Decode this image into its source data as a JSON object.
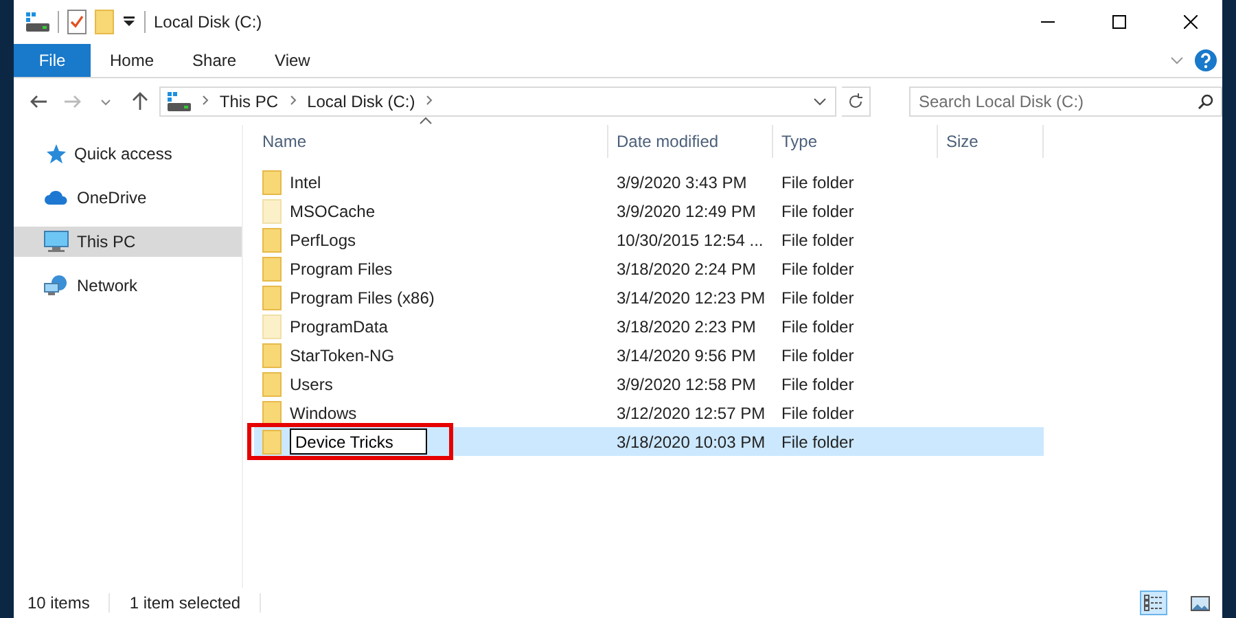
{
  "window": {
    "title": "Local Disk (C:)"
  },
  "ribbon_tabs": [
    {
      "label": "File",
      "kind": "file",
      "selected": false
    },
    {
      "label": "Home",
      "kind": "tab",
      "selected": false
    },
    {
      "label": "Share",
      "kind": "tab",
      "selected": false
    },
    {
      "label": "View",
      "kind": "tab",
      "selected": false
    }
  ],
  "address_bar": {
    "breadcrumbs": [
      "This PC",
      "Local Disk (C:)"
    ]
  },
  "search": {
    "placeholder": "Search Local Disk (C:)"
  },
  "sidebar": {
    "items": [
      {
        "label": "Quick access",
        "kind": "quick",
        "selected": false
      },
      {
        "label": "OneDrive",
        "kind": "cloud",
        "selected": false
      },
      {
        "label": "This PC",
        "kind": "pc",
        "selected": true
      },
      {
        "label": "Network",
        "kind": "network",
        "selected": false
      }
    ]
  },
  "table": {
    "columns": [
      "Name",
      "Date modified",
      "Type",
      "Size"
    ],
    "rows": [
      {
        "name": "Intel",
        "date": "3/9/2020 3:43 PM",
        "type": "File folder",
        "hidden": false,
        "selected": false,
        "editing": false,
        "highlighted": false
      },
      {
        "name": "MSOCache",
        "date": "3/9/2020 12:49 PM",
        "type": "File folder",
        "hidden": true,
        "selected": false,
        "editing": false,
        "highlighted": false
      },
      {
        "name": "PerfLogs",
        "date": "10/30/2015 12:54 ...",
        "type": "File folder",
        "hidden": false,
        "selected": false,
        "editing": false,
        "highlighted": false
      },
      {
        "name": "Program Files",
        "date": "3/18/2020 2:24 PM",
        "type": "File folder",
        "hidden": false,
        "selected": false,
        "editing": false,
        "highlighted": false
      },
      {
        "name": "Program Files (x86)",
        "date": "3/14/2020 12:23 PM",
        "type": "File folder",
        "hidden": false,
        "selected": false,
        "editing": false,
        "highlighted": false
      },
      {
        "name": "ProgramData",
        "date": "3/18/2020 2:23 PM",
        "type": "File folder",
        "hidden": true,
        "selected": false,
        "editing": false,
        "highlighted": false
      },
      {
        "name": "StarToken-NG",
        "date": "3/14/2020 9:56 PM",
        "type": "File folder",
        "hidden": false,
        "selected": false,
        "editing": false,
        "highlighted": false
      },
      {
        "name": "Users",
        "date": "3/9/2020 12:58 PM",
        "type": "File folder",
        "hidden": false,
        "selected": false,
        "editing": false,
        "highlighted": false
      },
      {
        "name": "Windows",
        "date": "3/12/2020 12:57 PM",
        "type": "File folder",
        "hidden": false,
        "selected": false,
        "editing": false,
        "highlighted": false
      },
      {
        "name": "Device Tricks",
        "date": "3/18/2020 10:03 PM",
        "type": "File folder",
        "hidden": false,
        "selected": true,
        "editing": true,
        "highlighted": true
      }
    ]
  },
  "status_bar": {
    "item_count": "10 items",
    "selection": "1 item selected",
    "view_buttons": [
      {
        "kind": "details",
        "selected": true
      },
      {
        "kind": "thumbnails",
        "selected": false
      }
    ]
  }
}
